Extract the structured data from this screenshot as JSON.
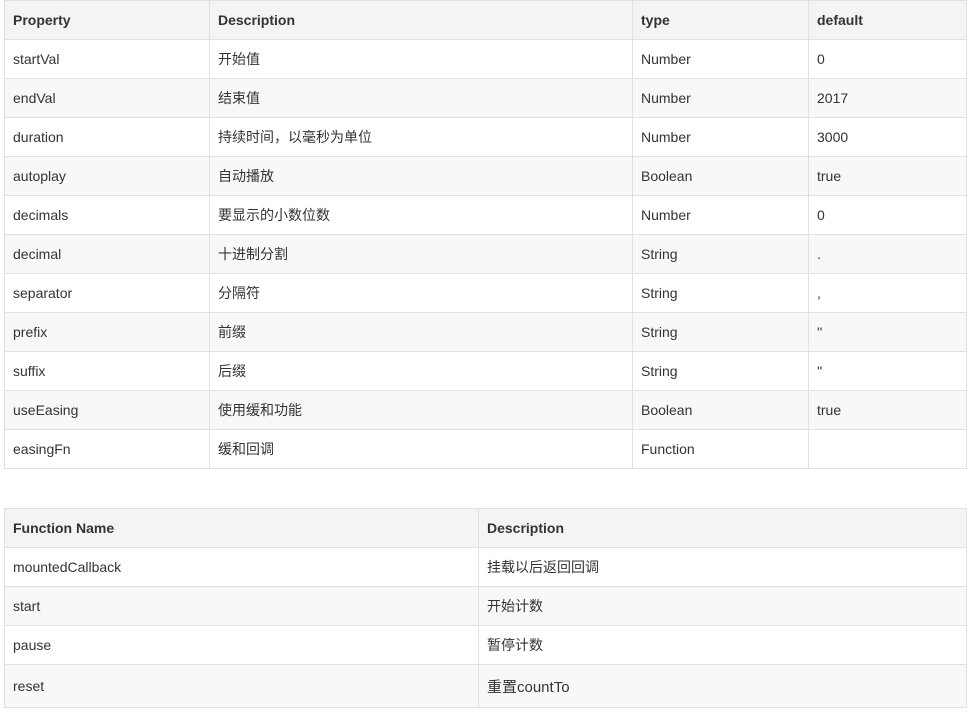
{
  "properties_table": {
    "headers": [
      "Property",
      "Description",
      "type",
      "default"
    ],
    "rows": [
      [
        "startVal",
        "开始值",
        "Number",
        "0"
      ],
      [
        "endVal",
        "结束值",
        "Number",
        "2017"
      ],
      [
        "duration",
        "持续时间，以毫秒为单位",
        "Number",
        "3000"
      ],
      [
        "autoplay",
        "自动播放",
        "Boolean",
        "true"
      ],
      [
        "decimals",
        "要显示的小数位数",
        "Number",
        "0"
      ],
      [
        "decimal",
        "十进制分割",
        "String",
        "."
      ],
      [
        "separator",
        "分隔符",
        "String",
        ","
      ],
      [
        "prefix",
        "前缀",
        "String",
        "''"
      ],
      [
        "suffix",
        "后缀",
        "String",
        "''"
      ],
      [
        "useEasing",
        "使用缓和功能",
        "Boolean",
        "true"
      ],
      [
        "easingFn",
        "缓和回调",
        "Function",
        ""
      ]
    ]
  },
  "functions_table": {
    "headers": [
      "Function Name",
      "Description"
    ],
    "rows": [
      [
        "mountedCallback",
        "挂载以后返回回调"
      ],
      [
        "start",
        "开始计数"
      ],
      [
        "pause",
        "暂停计数"
      ],
      [
        "reset",
        "重置countTo"
      ]
    ]
  }
}
